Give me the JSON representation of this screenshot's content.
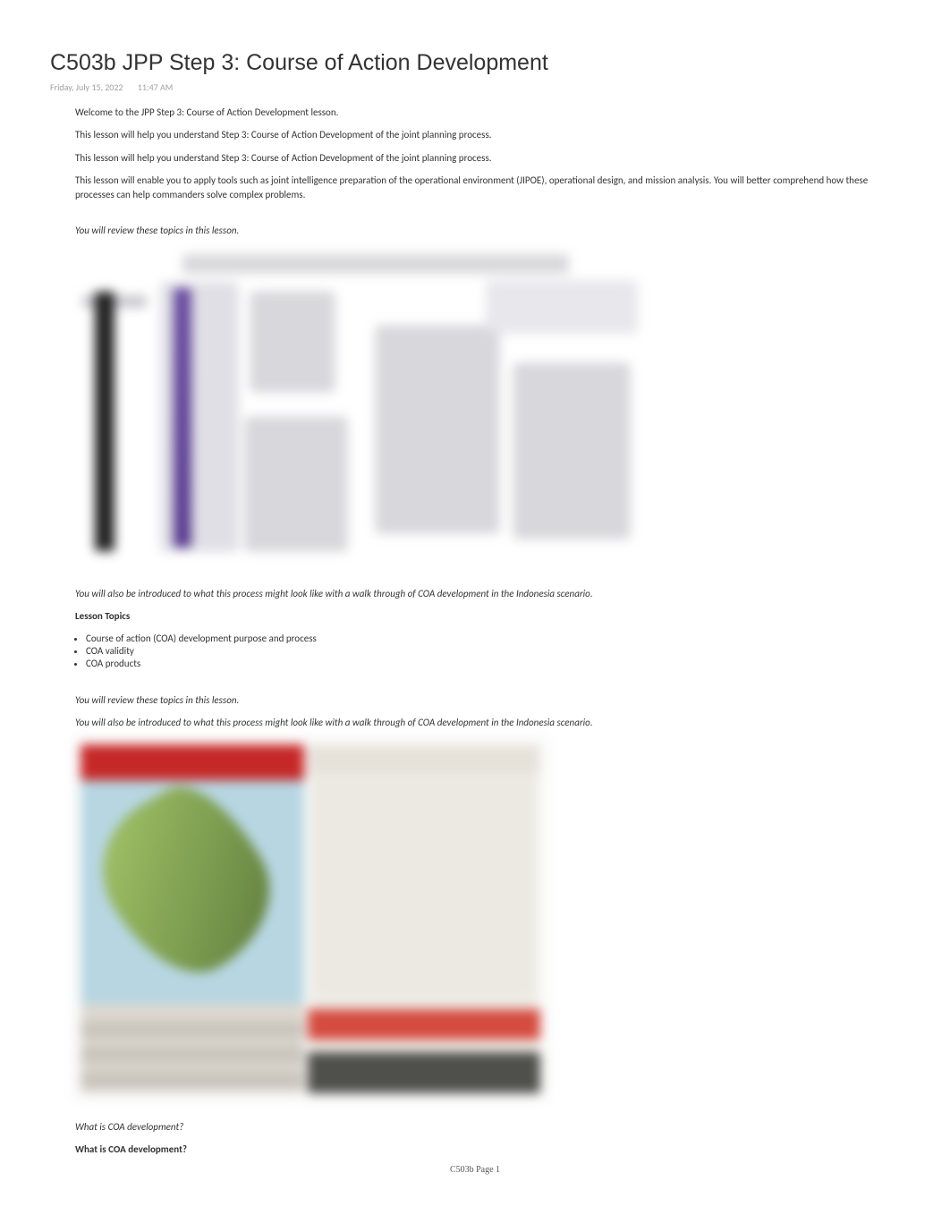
{
  "header": {
    "title": "C503b JPP Step 3: Course of Action Development",
    "date": "Friday, July 15, 2022",
    "time": "11:47 AM"
  },
  "body": {
    "p1": "Welcome to the JPP Step 3: Course of Action Development lesson.",
    "p2": "This lesson will help you understand Step 3: Course of Action Development of the joint planning process.",
    "p3": "This lesson will help you understand Step 3: Course of Action Development of the joint planning process.",
    "p4": "This lesson will enable you to apply tools such as joint intelligence preparation of the operational environment (JIPOE), operational design, and mission analysis. You will better comprehend how these processes can help commanders solve complex problems.",
    "p5": "You will review these topics in this lesson.",
    "p6": "You will also be introduced to what this process might look like with a walk through of COA development in the Indonesia scenario.",
    "lesson_topics_header": "Lesson Topics",
    "topics": [
      "Course of action (COA) development purpose and process",
      "COA validity",
      "COA products"
    ],
    "p7": "You will review these topics in this lesson.",
    "p8": "You will also be introduced to what this process might look like with a walk through of COA development in the Indonesia scenario.",
    "p9": "What is COA development?",
    "p10": "What is COA development?"
  },
  "footer": {
    "page_label": "C503b Page 1"
  }
}
